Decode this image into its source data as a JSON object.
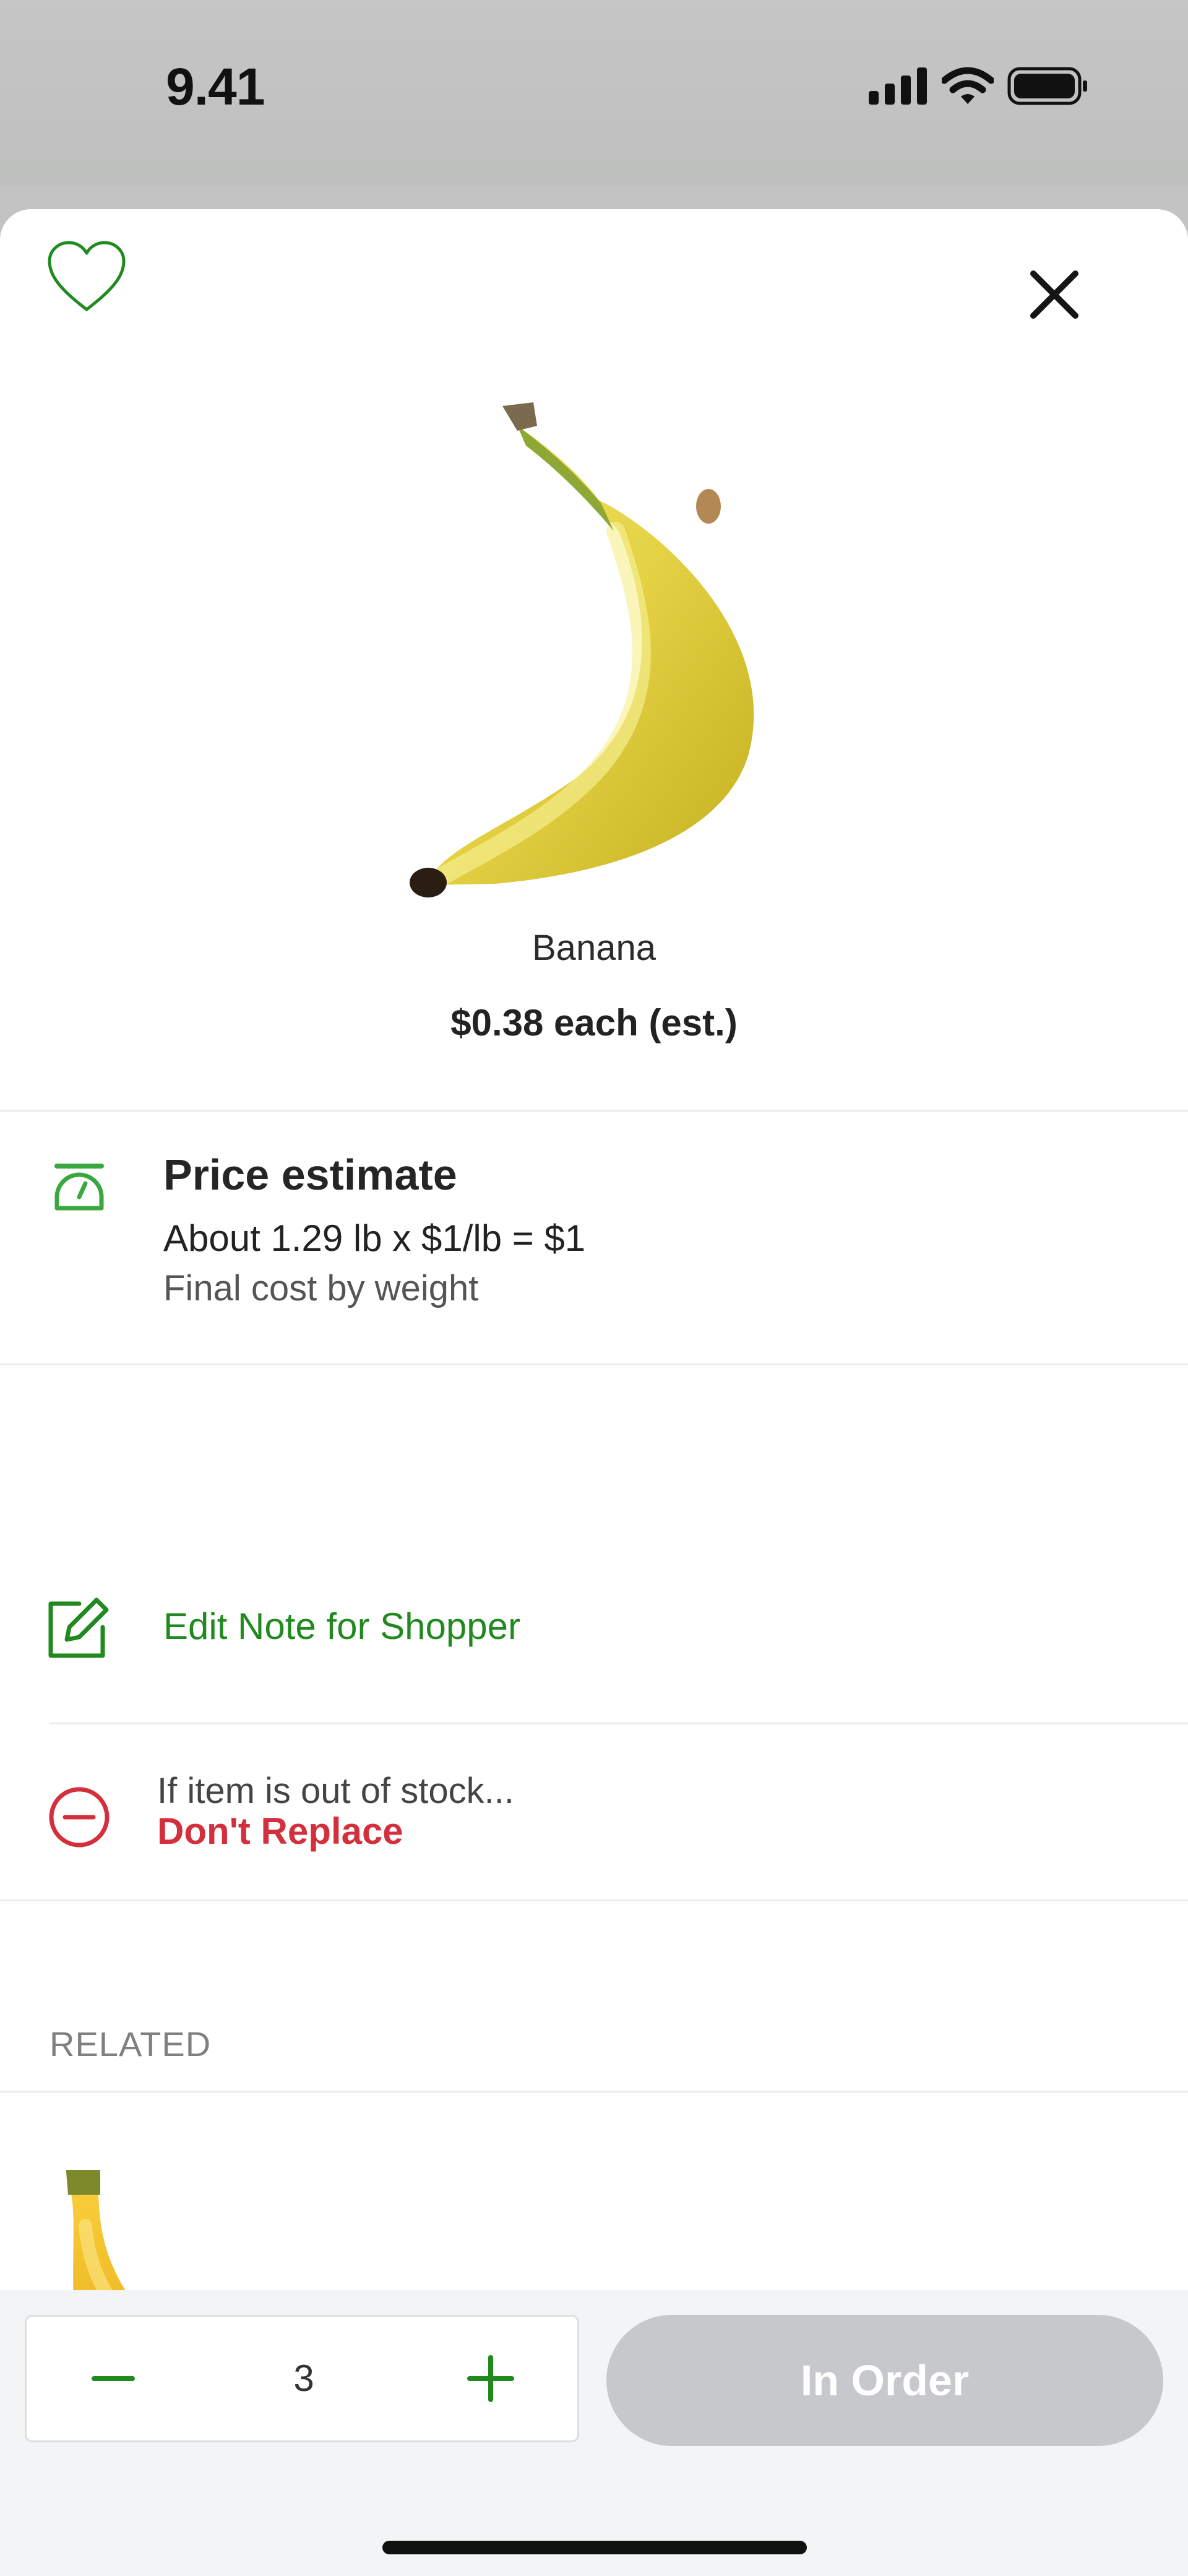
{
  "status_bar": {
    "time": "9.41"
  },
  "product": {
    "name": "Banana",
    "price": "$0.38 each (est.)"
  },
  "price_estimate": {
    "title": "Price estimate",
    "formula": "About 1.29 lb x $1/lb = $1",
    "note": "Final cost by weight"
  },
  "note_for_shopper": {
    "label": "Edit Note for Shopper"
  },
  "replacement": {
    "label": "If item is out of stock...",
    "value": "Don't Replace"
  },
  "related": {
    "heading": "RELATED"
  },
  "cart": {
    "quantity": "3",
    "button_label": "In Order"
  },
  "icons": {
    "favorite": "heart-icon",
    "close": "close-icon",
    "price": "scale-icon",
    "note": "edit-note-icon",
    "replace": "minus-circle-icon",
    "decrement": "minus-icon",
    "increment": "plus-icon"
  },
  "colors": {
    "accent_green": "#218a1f",
    "danger_red": "#d32f3c",
    "disabled_button": "#c7c8cb"
  }
}
